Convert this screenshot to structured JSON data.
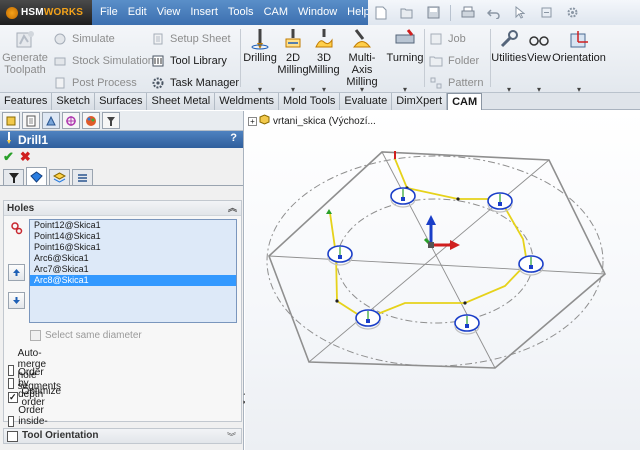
{
  "logo": {
    "hsm": "HSM",
    "works": "WORKS"
  },
  "menu": [
    "File",
    "Edit",
    "View",
    "Insert",
    "Tools",
    "CAM",
    "Window",
    "Help"
  ],
  "ribbon": {
    "generate_toolpath": "Generate\nToolpath",
    "simulate": "Simulate",
    "stock_simulation": "Stock Simulation",
    "post_process": "Post Process",
    "setup_sheet": "Setup Sheet",
    "tool_library": "Tool Library",
    "task_manager": "Task Manager",
    "drilling": "Drilling",
    "milling_2d": "2D\nMilling",
    "milling_3d": "3D\nMilling",
    "multi_axis": "Multi-Axis\nMilling",
    "turning": "Turning",
    "job": "Job",
    "folder": "Folder",
    "pattern": "Pattern",
    "utilities": "Utilities",
    "view": "View",
    "orientation": "Orientation"
  },
  "tabs": [
    "Features",
    "Sketch",
    "Surfaces",
    "Sheet Metal",
    "Weldments",
    "Mold Tools",
    "Evaluate",
    "DimXpert",
    "CAM"
  ],
  "active_tab": "CAM",
  "panel": {
    "title": "Drill1",
    "help": "?",
    "holes_group": "Holes",
    "holes": [
      {
        "label": "Point12@Skica1",
        "selected": false
      },
      {
        "label": "Point14@Skica1",
        "selected": false
      },
      {
        "label": "Point16@Skica1",
        "selected": false
      },
      {
        "label": "Arc6@Skica1",
        "selected": false
      },
      {
        "label": "Arc7@Skica1",
        "selected": false
      },
      {
        "label": "Arc8@Skica1",
        "selected": true
      }
    ],
    "select_same_diameter": "Select same diameter",
    "options": [
      {
        "label": "Auto-merge hole segments",
        "checked": false
      },
      {
        "label": "Order by depth",
        "checked": false
      },
      {
        "label": "Optimize order",
        "checked": true
      },
      {
        "label": "Order inside-out",
        "checked": false
      }
    ],
    "tool_orientation": "Tool Orientation"
  },
  "viewport": {
    "tree_label": "vrtani_skica  (Výchozí..."
  },
  "colors": {
    "title_bar": "#3c6faf",
    "selection": "#3399ff",
    "path": "#e6d21a",
    "hole_ring": "#1a3ec8"
  }
}
